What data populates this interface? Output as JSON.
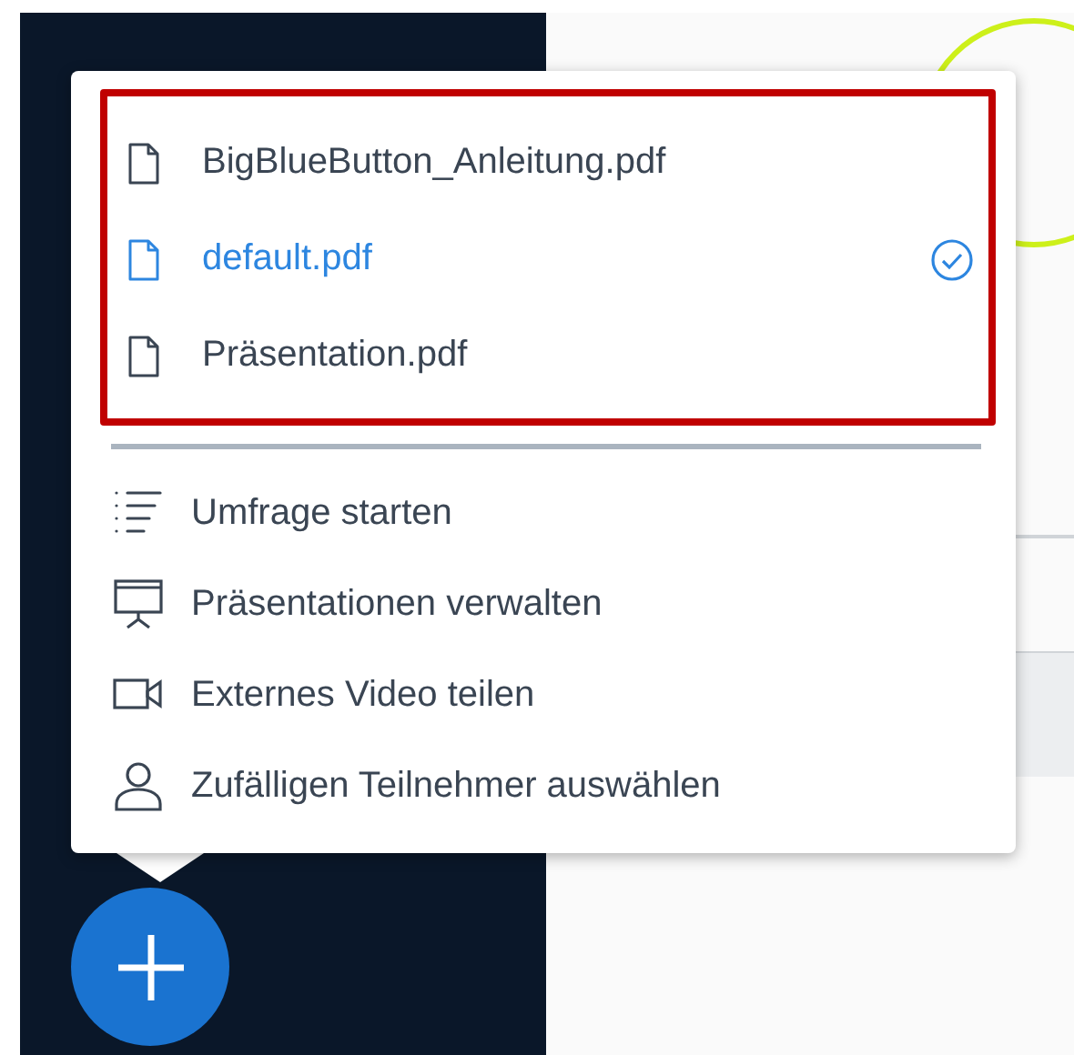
{
  "menu": {
    "files": [
      {
        "name": "BigBlueButton_Anleitung.pdf",
        "selected": false
      },
      {
        "name": "default.pdf",
        "selected": true
      },
      {
        "name": "Präsentation.pdf",
        "selected": false
      }
    ],
    "actions": [
      {
        "kind": "poll",
        "label": "Umfrage starten"
      },
      {
        "kind": "presentation",
        "label": "Präsentationen verwalten"
      },
      {
        "kind": "video",
        "label": "Externes Video teilen"
      },
      {
        "kind": "user",
        "label": "Zufälligen Teilnehmer auswählen"
      }
    ]
  }
}
